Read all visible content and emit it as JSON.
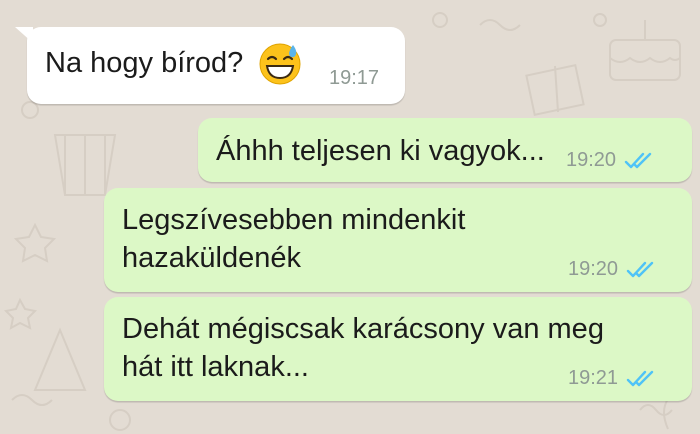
{
  "chat": {
    "messages": [
      {
        "direction": "incoming",
        "text": "Na hogy bírod?",
        "emoji": "grinning-face-with-sweat-emoji",
        "time": "19:17"
      },
      {
        "direction": "outgoing",
        "text": "Áhhh teljesen ki vagyok...",
        "time": "19:20",
        "status": "read"
      },
      {
        "direction": "outgoing",
        "lines": [
          "Legszívesebben mindenkit",
          "hazaküldenék"
        ],
        "time": "19:20",
        "status": "read"
      },
      {
        "direction": "outgoing",
        "lines": [
          "Dehát mégiscsak karácsony van meg",
          "hát itt laknak..."
        ],
        "time": "19:21",
        "status": "read"
      }
    ]
  },
  "colors": {
    "wallpaper": "#e3dcd3",
    "incoming_bubble": "#ffffff",
    "outgoing_bubble": "#dcf8c6",
    "read_ticks": "#4fc3f7",
    "timestamp": "#8f9a94"
  }
}
